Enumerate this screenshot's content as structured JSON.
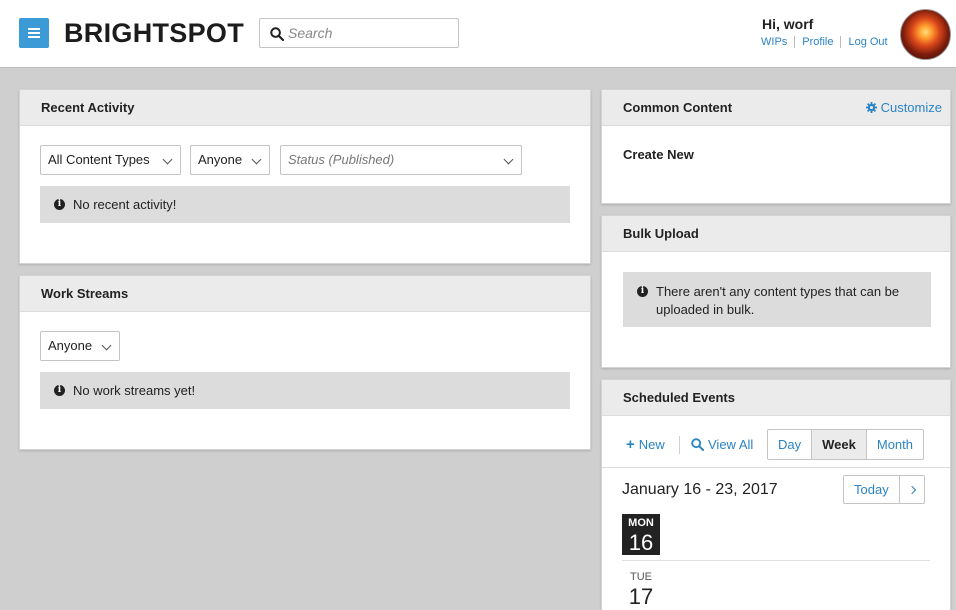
{
  "header": {
    "brand": "BRIGHTSPOT",
    "search_placeholder": "Search",
    "greeting": "Hi, worf",
    "links": [
      "WIPs",
      "Profile",
      "Log Out"
    ],
    "accent_color": "#3c9bd6"
  },
  "recent_activity": {
    "title": "Recent Activity",
    "filters": {
      "content_types": "All Content Types",
      "user": "Anyone",
      "status_placeholder": "Status (Published)"
    },
    "empty_message": "No recent activity!"
  },
  "work_streams": {
    "title": "Work Streams",
    "filter_user": "Anyone",
    "empty_message": "No work streams yet!"
  },
  "common_content": {
    "title": "Common Content",
    "customize_label": "Customize",
    "create_new_label": "Create New"
  },
  "bulk_upload": {
    "title": "Bulk Upload",
    "message": "There aren't any content types that can be uploaded in bulk."
  },
  "scheduled_events": {
    "title": "Scheduled Events",
    "new_label": "New",
    "view_all_label": "View All",
    "views": [
      "Day",
      "Week",
      "Month"
    ],
    "active_view": "Week",
    "date_range": "January 16 - 23, 2017",
    "today_label": "Today",
    "days": [
      {
        "dow": "MON",
        "num": "16",
        "current": true
      },
      {
        "dow": "TUE",
        "num": "17",
        "current": false
      }
    ]
  }
}
